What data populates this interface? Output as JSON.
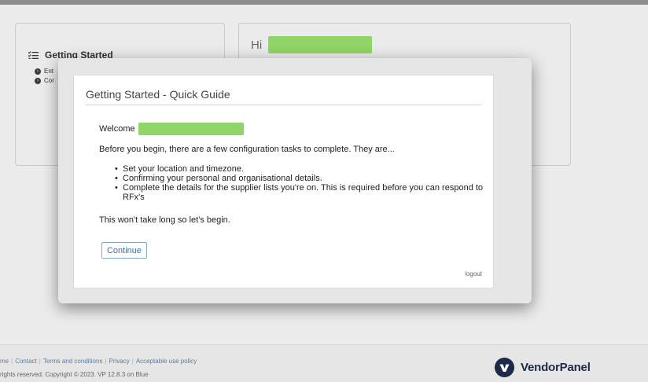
{
  "dashboard": {
    "getting_started": {
      "title": "Getting Started",
      "items": [
        {
          "label": "Ent"
        },
        {
          "label": "Cor"
        }
      ]
    },
    "greeting": {
      "prefix": "Hi"
    }
  },
  "modal": {
    "title": "Getting Started - Quick Guide",
    "welcome_prefix": "Welcome",
    "intro": "Before you begin, there are a few configuration tasks to complete. They are...",
    "tasks": [
      "Set your location and timezone.",
      "Confirming your personal and organisational details.",
      "Complete the details for the supplier lists you're on. This is required before you can respond to RFx's"
    ],
    "closing": "This won't take long so let's begin.",
    "continue_label": "Continue",
    "logout_label": "logout"
  },
  "footer": {
    "links": [
      {
        "label": "me"
      },
      {
        "label": "Contact"
      },
      {
        "label": "Terms and conditions"
      },
      {
        "label": "Privacy"
      },
      {
        "label": "Acceptable use policy"
      }
    ],
    "copyright": "rights reserved. Copyright © 2023. VP 12.8.3 on Blue"
  },
  "brand": {
    "name": "VendorPanel"
  },
  "colors": {
    "redaction": "#8fd567",
    "link": "#5a7da0",
    "brand_dark": "#1d2a48"
  },
  "icons": {
    "getting_started": "list-check-icon",
    "item": "circle-chevron-icon",
    "logo": "vendorpanel-logo-icon"
  }
}
